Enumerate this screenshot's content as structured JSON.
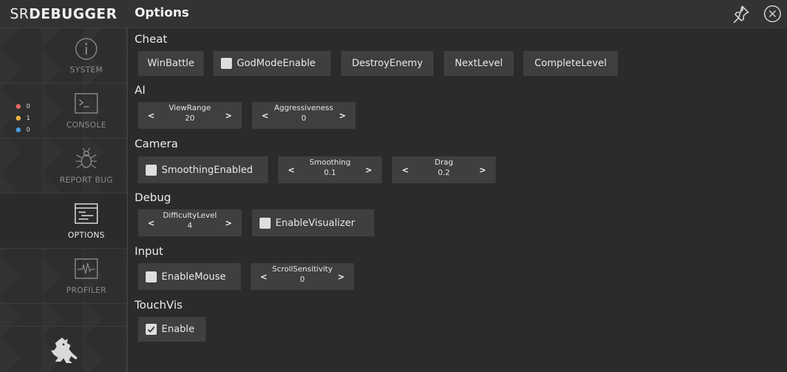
{
  "logo": {
    "thin": "SR",
    "bold": "DEBUGGER"
  },
  "header": {
    "title": "Options"
  },
  "icons": {
    "pin": "pin-icon",
    "close": "close-circle-icon"
  },
  "sidebar": {
    "tabs": [
      {
        "label": "SYSTEM",
        "icon": "info-icon"
      },
      {
        "label": "CONSOLE",
        "icon": "terminal-icon"
      },
      {
        "label": "REPORT BUG",
        "icon": "bug-icon"
      },
      {
        "label": "OPTIONS",
        "icon": "options-icon"
      },
      {
        "label": "PROFILER",
        "icon": "profiler-icon"
      }
    ],
    "console_counts": [
      {
        "color": "#e06a5f",
        "value": "0"
      },
      {
        "color": "#e9b24a",
        "value": "1"
      },
      {
        "color": "#4a9be0",
        "value": "0"
      }
    ]
  },
  "sections": {
    "cheat": {
      "title": "Cheat",
      "win_battle": "WinBattle",
      "god_mode": "GodModeEnable",
      "destroy_enemy": "DestroyEnemy",
      "next_level": "NextLevel",
      "complete_level": "CompleteLevel"
    },
    "ai": {
      "title": "AI",
      "view_range": {
        "label": "ViewRange",
        "value": "20"
      },
      "aggressiveness": {
        "label": "Aggressiveness",
        "value": "0"
      }
    },
    "camera": {
      "title": "Camera",
      "smoothing_enabled": "SmoothingEnabled",
      "smoothing": {
        "label": "Smoothing",
        "value": "0.1"
      },
      "drag": {
        "label": "Drag",
        "value": "0.2"
      }
    },
    "debug": {
      "title": "Debug",
      "difficulty_level": {
        "label": "DifficultyLevel",
        "value": "4"
      },
      "enable_visualizer": "EnableVisualizer"
    },
    "input": {
      "title": "Input",
      "enable_mouse": "EnableMouse",
      "scroll_sensitivity": {
        "label": "ScrollSensitivity",
        "value": "0"
      }
    },
    "touchvis": {
      "title": "TouchVis",
      "enable": "Enable",
      "enable_checked": true
    }
  },
  "arrows": {
    "left": "<",
    "right": ">"
  }
}
